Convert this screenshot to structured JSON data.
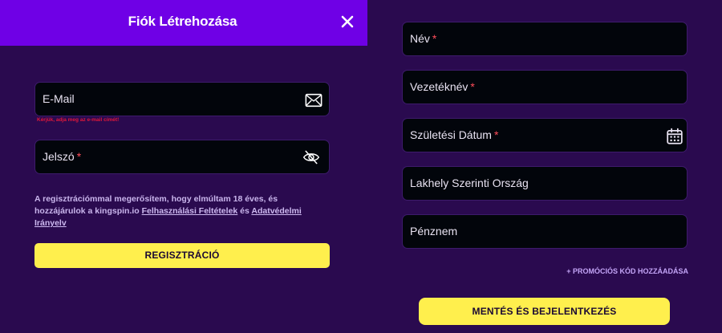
{
  "header": {
    "title": "Fiók Létrehozása"
  },
  "left_form": {
    "email_label": "E-Mail",
    "email_error": "Kérjük, adja meg az e-mail címét!",
    "password_label": "Jelszó",
    "required_mark": "*",
    "terms_prefix": "A regisztrációmmal megerősítem, hogy elmúltam 18 éves, és hozzájárulok a kingspin.io ",
    "terms_link": "Felhasználási Feltételek",
    "terms_and": " és ",
    "privacy_link": "Adatvédelmi Irányelv",
    "register_button": "REGISZTRÁCIÓ"
  },
  "right_form": {
    "name_label": "Név",
    "surname_label": "Vezetéknév",
    "birth_label": "Születési Dátum",
    "country_label": "Lakhely Szerinti Ország",
    "currency_label": "Pénznem",
    "required_mark": "*",
    "promo_link": "+ PROMÓCIÓS KÓD HOZZÁADÁSA",
    "save_button": "MENTÉS ÉS BEJELENTKEZÉS"
  },
  "icons": {
    "close": "close-icon",
    "email": "envelope-icon",
    "password": "eye-off-icon",
    "date": "calendar-icon"
  },
  "colors": {
    "background": "#2a0a4f",
    "header": "#6f00e6",
    "field_bg": "#02050b",
    "accent_yellow": "#ffef4d",
    "error_red": "#e0173a"
  }
}
